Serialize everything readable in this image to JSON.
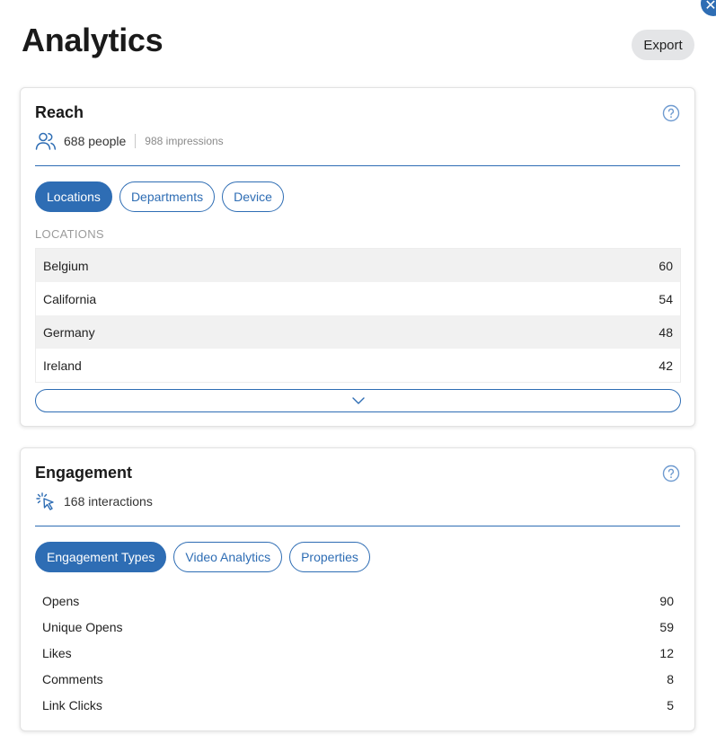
{
  "header": {
    "title": "Analytics",
    "export_label": "Export"
  },
  "reach": {
    "title": "Reach",
    "people": "688 people",
    "impressions": "988 impressions",
    "tabs": [
      {
        "label": "Locations",
        "active": true
      },
      {
        "label": "Departments",
        "active": false
      },
      {
        "label": "Device",
        "active": false
      }
    ],
    "section_label": "LOCATIONS",
    "rows": [
      {
        "name": "Belgium",
        "value": "60"
      },
      {
        "name": "California",
        "value": "54"
      },
      {
        "name": "Germany",
        "value": "48"
      },
      {
        "name": "Ireland",
        "value": "42"
      }
    ]
  },
  "engagement": {
    "title": "Engagement",
    "interactions": "168 interactions",
    "tabs": [
      {
        "label": "Engagement Types",
        "active": true
      },
      {
        "label": "Video Analytics",
        "active": false
      },
      {
        "label": "Properties",
        "active": false
      }
    ],
    "rows": [
      {
        "name": "Opens",
        "value": "90"
      },
      {
        "name": "Unique Opens",
        "value": "59"
      },
      {
        "name": "Likes",
        "value": "12"
      },
      {
        "name": "Comments",
        "value": "8"
      },
      {
        "name": "Link Clicks",
        "value": "5"
      }
    ]
  },
  "colors": {
    "accent": "#2e6db4",
    "row_alt": "#f1f1f1",
    "export_bg": "#e4e5e7"
  },
  "icons": {
    "close": "close-icon",
    "help": "question-circle-icon",
    "people": "users-icon",
    "interactions": "cursor-click-icon",
    "expand": "chevron-down-icon"
  }
}
